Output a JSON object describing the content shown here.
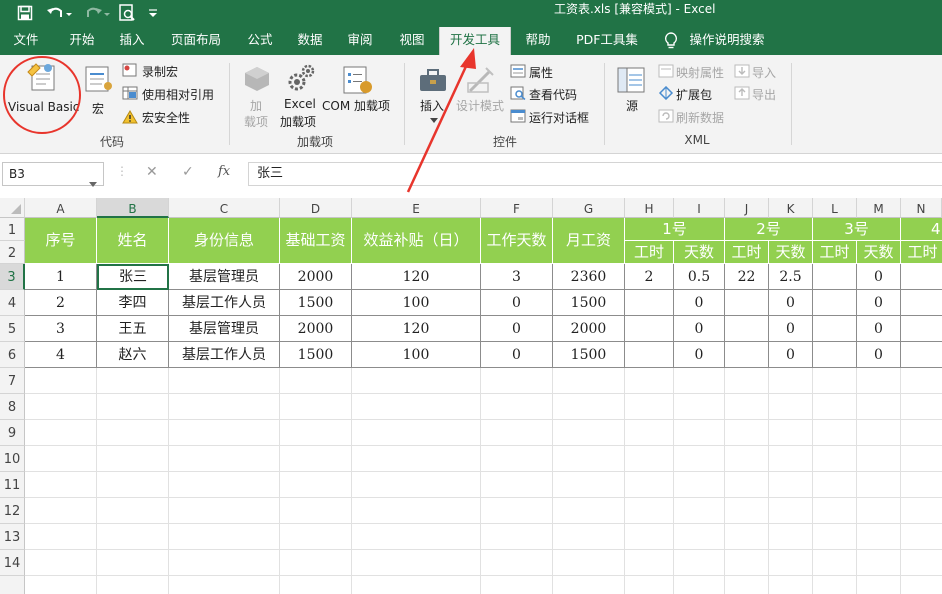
{
  "window": {
    "title": "工资表.xls  [兼容模式]  -  Excel"
  },
  "colors": {
    "excel_green": "#217346",
    "header_fill": "#92d050",
    "arrow": "#e8352c",
    "circle": "#e8352c"
  },
  "tabs": [
    "文件",
    "开始",
    "插入",
    "页面布局",
    "公式",
    "数据",
    "审阅",
    "视图",
    "开发工具",
    "帮助",
    "PDF工具集",
    "操作说明搜索"
  ],
  "ribbon": {
    "code": {
      "vb": "Visual Basic",
      "macro": "宏",
      "record": "录制宏",
      "relative": "使用相对引用",
      "security": "宏安全性",
      "group": "代码"
    },
    "addins": {
      "addin1": "加",
      "addin2": "载项",
      "excel_addin1": "Excel",
      "excel_addin2": "加载项",
      "com": "COM 加载项",
      "group": "加载项"
    },
    "controls": {
      "insert": "插入",
      "design": "设计模式",
      "props": "属性",
      "viewcode": "查看代码",
      "dialog": "运行对话框",
      "group": "控件"
    },
    "xml": {
      "source": "源",
      "map_props": "映射属性",
      "expand": "扩展包",
      "refresh": "刷新数据",
      "import": "导入",
      "export": "导出",
      "group": "XML"
    }
  },
  "formula_bar": {
    "name_box": "B3",
    "formula": "张三"
  },
  "columns": [
    "A",
    "B",
    "C",
    "D",
    "E",
    "F",
    "G",
    "H",
    "I",
    "J",
    "K",
    "L",
    "M",
    "N"
  ],
  "rows": [
    "1",
    "2",
    "3",
    "4",
    "5",
    "6",
    "7",
    "8",
    "9",
    "10",
    "11",
    "12",
    "13",
    "14"
  ],
  "headers": {
    "seq": "序号",
    "name": "姓名",
    "identity": "身份信息",
    "base": "基础工资",
    "bonus": "效益补贴（日）",
    "days": "工作天数",
    "monthly": "月工资",
    "d1": "1号",
    "d2": "2号",
    "d3": "3号",
    "d4": "4",
    "hours": "工时",
    "daycount": "天数"
  },
  "data": [
    [
      "1",
      "张三",
      "基层管理员",
      "2000",
      "120",
      "3",
      "2360",
      "2",
      "0.5",
      "22",
      "2.5",
      "",
      "0"
    ],
    [
      "2",
      "李四",
      "基层工作人员",
      "1500",
      "100",
      "0",
      "1500",
      "",
      "0",
      "",
      "0",
      "",
      "0"
    ],
    [
      "3",
      "王五",
      "基层管理员",
      "2000",
      "120",
      "0",
      "2000",
      "",
      "0",
      "",
      "0",
      "",
      "0"
    ],
    [
      "4",
      "赵六",
      "基层工作人员",
      "1500",
      "100",
      "0",
      "1500",
      "",
      "0",
      "",
      "0",
      "",
      "0"
    ]
  ]
}
